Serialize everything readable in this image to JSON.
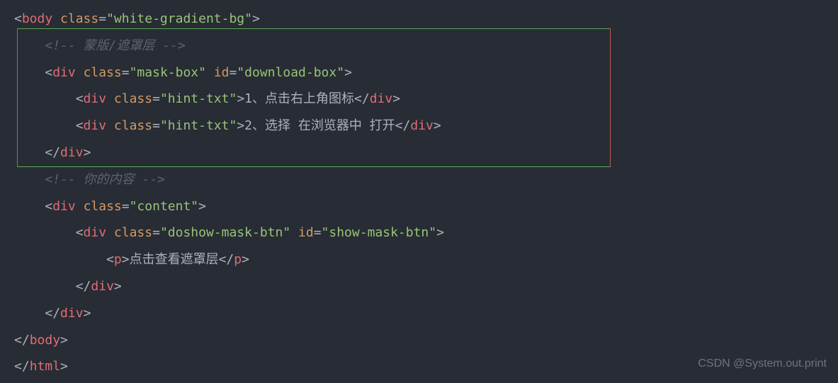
{
  "code": {
    "line1": {
      "open": "<",
      "tag": "body",
      "attr": "class",
      "eq": "=",
      "val": "\"white-gradient-bg\"",
      "close": ">"
    },
    "line2": {
      "comment": "<!-- 蒙版/遮罩层 -->"
    },
    "line3": {
      "open": "<",
      "tag": "div",
      "attr1": "class",
      "val1": "\"mask-box\"",
      "attr2": "id",
      "val2": "\"download-box\"",
      "eq": "=",
      "close": ">"
    },
    "line4": {
      "open": "<",
      "tag": "div",
      "attr": "class",
      "eq": "=",
      "val": "\"hint-txt\"",
      "mid": ">",
      "text": "1、点击右上角图标",
      "close_open": "</",
      "close": ">"
    },
    "line5": {
      "open": "<",
      "tag": "div",
      "attr": "class",
      "eq": "=",
      "val": "\"hint-txt\"",
      "mid": ">",
      "text": "2、选择 在浏览器中 打开",
      "close_open": "</",
      "close": ">"
    },
    "line6": {
      "close_open": "</",
      "tag": "div",
      "close": ">"
    },
    "line7": {
      "comment": "<!-- 你的内容 -->"
    },
    "line8": {
      "open": "<",
      "tag": "div",
      "attr": "class",
      "eq": "=",
      "val": "\"content\"",
      "close": ">"
    },
    "line9": {
      "open": "<",
      "tag": "div",
      "attr1": "class",
      "val1": "\"doshow-mask-btn\"",
      "attr2": "id",
      "val2": "\"show-mask-btn\"",
      "eq": "=",
      "close": ">"
    },
    "line10": {
      "open": "<",
      "tag": "p",
      "mid": ">",
      "text": "点击查看遮罩层",
      "close_open": "</",
      "close": ">"
    },
    "line11": {
      "close_open": "</",
      "tag": "div",
      "close": ">"
    },
    "line12": {
      "close_open": "</",
      "tag": "div",
      "close": ">"
    },
    "line13": {
      "close_open": "</",
      "tag": "body",
      "close": ">"
    },
    "line14": {
      "close_open": "</",
      "tag": "html",
      "close": ">"
    }
  },
  "watermark": "CSDN @System.out.print"
}
